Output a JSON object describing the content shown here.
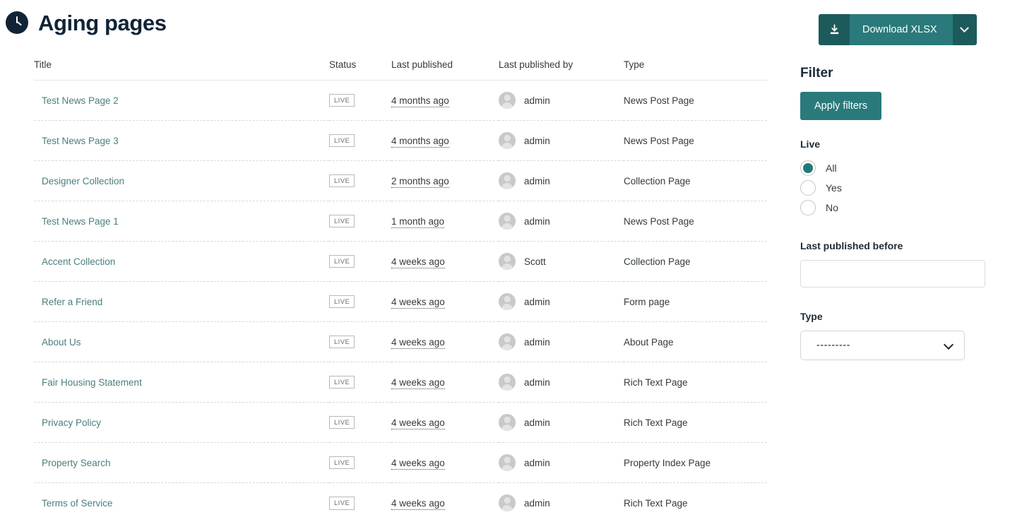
{
  "header": {
    "icon": "clock-icon",
    "title": "Aging pages"
  },
  "toolbar": {
    "download_icon": "download-icon",
    "download_label": "Download XLSX",
    "dropdown_icon": "chevron-down-icon"
  },
  "table": {
    "columns": [
      "Title",
      "Status",
      "Last published",
      "Last published by",
      "Type"
    ],
    "rows": [
      {
        "title": "Test News Page 2",
        "status": "LIVE",
        "last_published": "4 months ago",
        "published_by": "admin",
        "type": "News Post Page"
      },
      {
        "title": "Test News Page 3",
        "status": "LIVE",
        "last_published": "4 months ago",
        "published_by": "admin",
        "type": "News Post Page"
      },
      {
        "title": "Designer Collection",
        "status": "LIVE",
        "last_published": "2 months ago",
        "published_by": "admin",
        "type": "Collection Page"
      },
      {
        "title": "Test News Page 1",
        "status": "LIVE",
        "last_published": "1 month ago",
        "published_by": "admin",
        "type": "News Post Page"
      },
      {
        "title": "Accent Collection",
        "status": "LIVE",
        "last_published": "4 weeks ago",
        "published_by": "Scott",
        "type": "Collection Page"
      },
      {
        "title": "Refer a Friend",
        "status": "LIVE",
        "last_published": "4 weeks ago",
        "published_by": "admin",
        "type": "Form page"
      },
      {
        "title": "About Us",
        "status": "LIVE",
        "last_published": "4 weeks ago",
        "published_by": "admin",
        "type": "About Page"
      },
      {
        "title": "Fair Housing Statement",
        "status": "LIVE",
        "last_published": "4 weeks ago",
        "published_by": "admin",
        "type": "Rich Text Page"
      },
      {
        "title": "Privacy Policy",
        "status": "LIVE",
        "last_published": "4 weeks ago",
        "published_by": "admin",
        "type": "Rich Text Page"
      },
      {
        "title": "Property Search",
        "status": "LIVE",
        "last_published": "4 weeks ago",
        "published_by": "admin",
        "type": "Property Index Page"
      },
      {
        "title": "Terms of Service",
        "status": "LIVE",
        "last_published": "4 weeks ago",
        "published_by": "admin",
        "type": "Rich Text Page"
      }
    ]
  },
  "filter": {
    "heading": "Filter",
    "apply_label": "Apply filters",
    "live": {
      "label": "Live",
      "options": [
        "All",
        "Yes",
        "No"
      ],
      "selected": "All"
    },
    "last_published_before": {
      "label": "Last published before",
      "value": "",
      "placeholder": ""
    },
    "type": {
      "label": "Type",
      "selected": "---------",
      "options": [
        "---------"
      ],
      "chevron_icon": "chevron-down-icon"
    }
  },
  "colors": {
    "accent_teal": "#2a7a7b",
    "accent_teal_dark": "#1d5a5c",
    "link_teal": "#4b7e7e",
    "heading_navy": "#102436"
  }
}
